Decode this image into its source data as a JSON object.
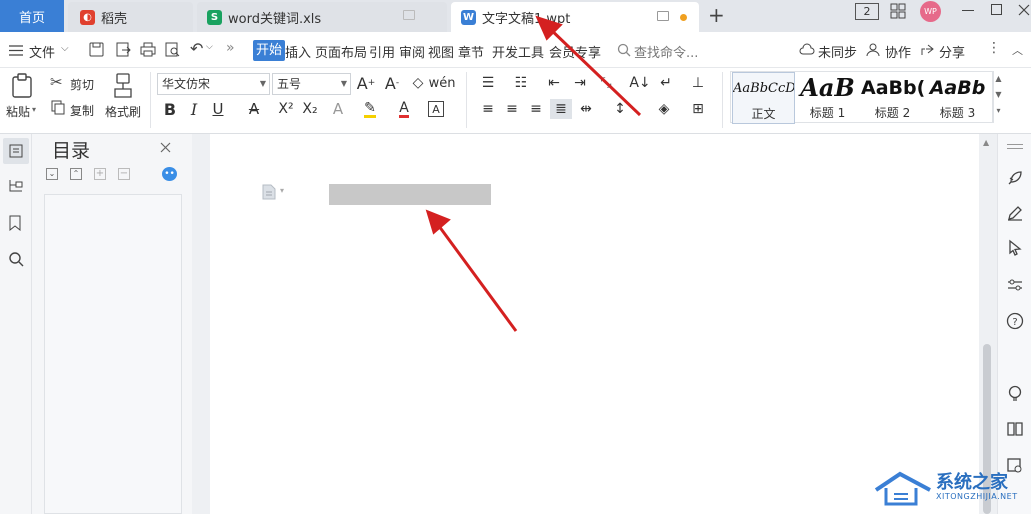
{
  "tabs": {
    "home": "首页",
    "daoke": "稻壳",
    "xls": "word关键词.xls",
    "doc": "文字文稿1.wpt",
    "new_tab_icon": "plus-icon"
  },
  "window": {
    "badge": "2",
    "avatar": "WP"
  },
  "menu": {
    "file": "文件",
    "start": "开始",
    "items": [
      "插入",
      "页面布局",
      "引用",
      "审阅",
      "视图",
      "章节",
      "开发工具",
      "会员专享"
    ],
    "search_placeholder": "查找命令...",
    "unsync": "未同步",
    "collab": "协作",
    "share": "分享"
  },
  "ribbon": {
    "paste": "粘贴",
    "cut": "剪切",
    "copy": "复制",
    "format_painter": "格式刷",
    "font_name": "华文仿宋",
    "font_size": "五号",
    "styles": [
      {
        "preview": "AaBbCcD",
        "label": "正文"
      },
      {
        "preview": "AaB",
        "label": "标题 1"
      },
      {
        "preview": "AaBb(",
        "label": "标题 2"
      },
      {
        "preview": "AaBb",
        "label": "标题 3"
      }
    ]
  },
  "toc": {
    "title": "目录"
  },
  "watermark": {
    "site": "系统之家",
    "url": "XITONGZHIJIA.NET"
  },
  "colors": {
    "accent": "#3a7fd5",
    "arrow": "#d42020",
    "selection": "#c8c8c8",
    "xls_green": "#1aa260",
    "daoke_red": "#e0402e"
  }
}
